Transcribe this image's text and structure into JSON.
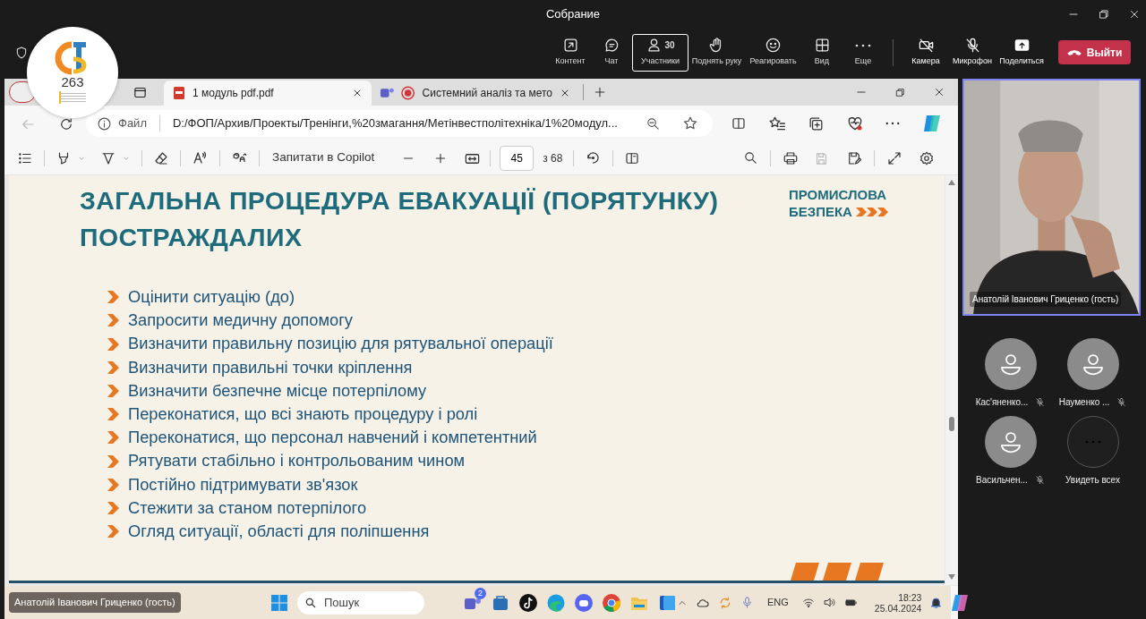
{
  "window": {
    "title": "Собрание"
  },
  "meeting_toolbar": {
    "items": [
      {
        "kind": "content",
        "label": "Контент",
        "selected": false
      },
      {
        "kind": "chat",
        "label": "Чат",
        "selected": false
      },
      {
        "kind": "people",
        "label": "Участники",
        "count": "30",
        "selected": true
      },
      {
        "kind": "hand",
        "label": "Поднять руку",
        "selected": false
      },
      {
        "kind": "react",
        "label": "Реагировать",
        "selected": false
      },
      {
        "kind": "view",
        "label": "Вид",
        "selected": false
      },
      {
        "kind": "more",
        "label": "Еще",
        "selected": false
      }
    ],
    "devices": [
      {
        "kind": "camera",
        "label": "Камера",
        "off": true
      },
      {
        "kind": "mic",
        "label": "Микрофон",
        "off": true
      },
      {
        "kind": "share",
        "label": "Поделиться",
        "off": false
      }
    ],
    "leave": "Выйти"
  },
  "logo": {
    "text": "263"
  },
  "browser": {
    "tabs": [
      {
        "kind": "pdf",
        "title": "1 модуль pdf.pdf",
        "selected": true,
        "recording": false
      },
      {
        "kind": "teams",
        "title": "Системний аналіз та мето",
        "selected": false,
        "recording": true
      }
    ],
    "address": {
      "scheme": "Файл",
      "url": "D:/ФОП/Архив/Проекты/Тренінги,%20змагання/Метінвестполітехніка/1%20модул..."
    },
    "pdf_toolbar": {
      "copilot": "Запитати в Copilot",
      "page": "45",
      "page_total": "з 68"
    }
  },
  "slide": {
    "title_lines": [
      "ЗАГАЛЬНА ПРОЦЕДУРА ЕВАКУАЦІЇ (ПОРЯТУНКУ)",
      "ПОСТРАЖДАЛИХ"
    ],
    "brand": [
      "ПРОМИСЛОВА",
      "БЕЗПЕКА"
    ],
    "bullets": [
      "Оцінити ситуацію (до)",
      "Запросити медичну допомогу",
      "Визначити правильну позицію для рятувальної операції",
      "Визначити правильні точки кріплення",
      "Визначити безпечне місце потерпілому",
      "Переконатися, що всі знають процедуру і ролі",
      "Переконатися, що персонал навчений і компетентний",
      "Рятувати стабільно і контрольованим чином",
      "Постійно підтримувати зв'язок",
      "Стежити за станом потерпілого",
      "Огляд ситуації, області для поліпшення"
    ]
  },
  "taskbar": {
    "search_placeholder": "Пошук",
    "teams_badge": "2",
    "language": "ENG",
    "time": "18:23",
    "date": "25.04.2024"
  },
  "speaker_label": "Анатолій Іванович Гриценко (гость)",
  "video_tile": {
    "kind": "picture",
    "name": "Анатолій Іванович Гриценко (гость)"
  },
  "participants": [
    {
      "name": "Кас'яненко...",
      "muted": true
    },
    {
      "name": "Науменко ...",
      "muted": true
    },
    {
      "name": "Васильчен...",
      "muted": true
    }
  ],
  "see_all": "Увидеть всех"
}
